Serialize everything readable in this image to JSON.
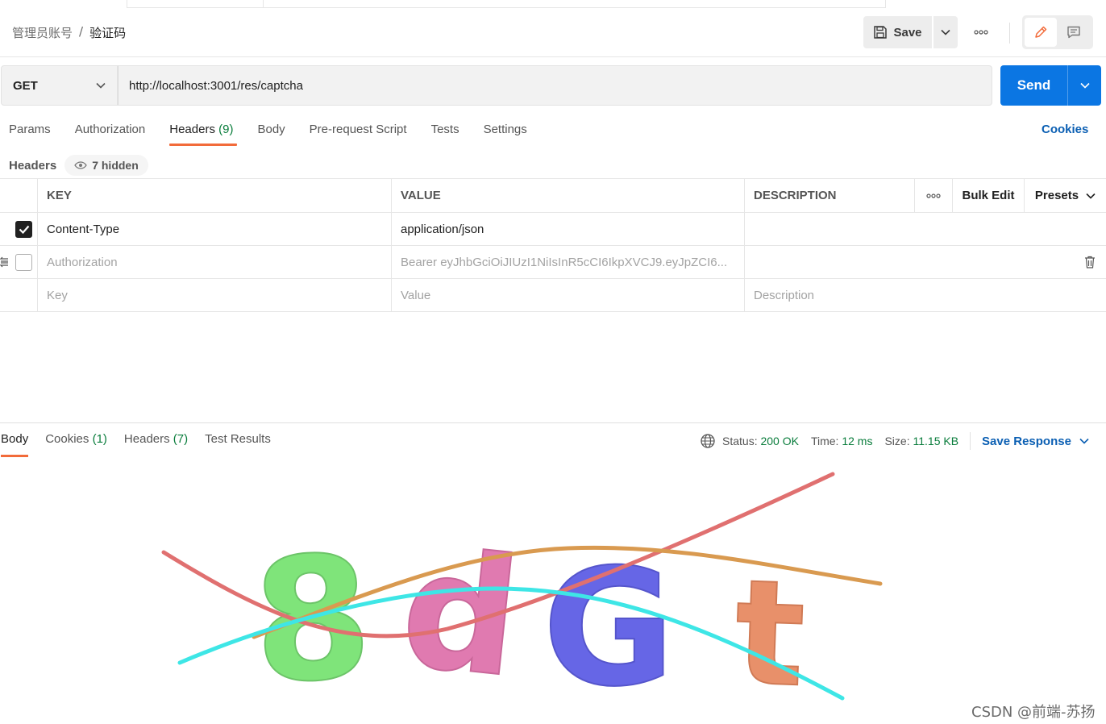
{
  "breadcrumb": {
    "parent": "管理员账号",
    "separator": "/",
    "current": "验证码"
  },
  "toolbar": {
    "save_label": "Save"
  },
  "request": {
    "method": "GET",
    "url": "http://localhost:3001/res/captcha",
    "send_label": "Send"
  },
  "request_tabs": {
    "params": "Params",
    "authorization": "Authorization",
    "headers": "Headers",
    "headers_count": "(9)",
    "body": "Body",
    "pre_request": "Pre-request Script",
    "tests": "Tests",
    "settings": "Settings",
    "cookies": "Cookies"
  },
  "headers_section": {
    "label": "Headers",
    "hidden": "7 hidden"
  },
  "table": {
    "columns": {
      "key": "KEY",
      "value": "VALUE",
      "description": "DESCRIPTION",
      "bulk_edit": "Bulk Edit",
      "presets": "Presets"
    },
    "rows": [
      {
        "checked": true,
        "key": "Content-Type",
        "value": "application/json",
        "description": ""
      },
      {
        "checked": false,
        "key": "Authorization",
        "value": "Bearer eyJhbGciOiJIUzI1NiIsInR5cCI6IkpXVCJ9.eyJpZCI6...",
        "description": ""
      }
    ],
    "placeholders": {
      "key": "Key",
      "value": "Value",
      "description": "Description"
    }
  },
  "response": {
    "tabs": {
      "body": "Body",
      "cookies": "Cookies",
      "cookies_count": "(1)",
      "headers": "Headers",
      "headers_count": "(7)",
      "test_results": "Test Results"
    },
    "status_label": "Status:",
    "status_value": "200 OK",
    "time_label": "Time:",
    "time_value": "12 ms",
    "size_label": "Size:",
    "size_value": "11.15 KB",
    "save_response": "Save Response",
    "captcha_text": "8dGt"
  },
  "colors": {
    "accent_orange": "#f26b3a",
    "send_blue": "#0b76e3",
    "link_blue": "#0b5fb3",
    "status_green": "#0a7d3c",
    "captcha_green": "#7fe47a",
    "captcha_pink": "#e07ab0",
    "captcha_blue": "#6666e6",
    "captcha_salmon": "#e8906a",
    "line_red": "#e07070",
    "line_orange": "#d99a50",
    "line_cyan": "#3ee6e6"
  },
  "watermark": "CSDN @前端-苏扬"
}
